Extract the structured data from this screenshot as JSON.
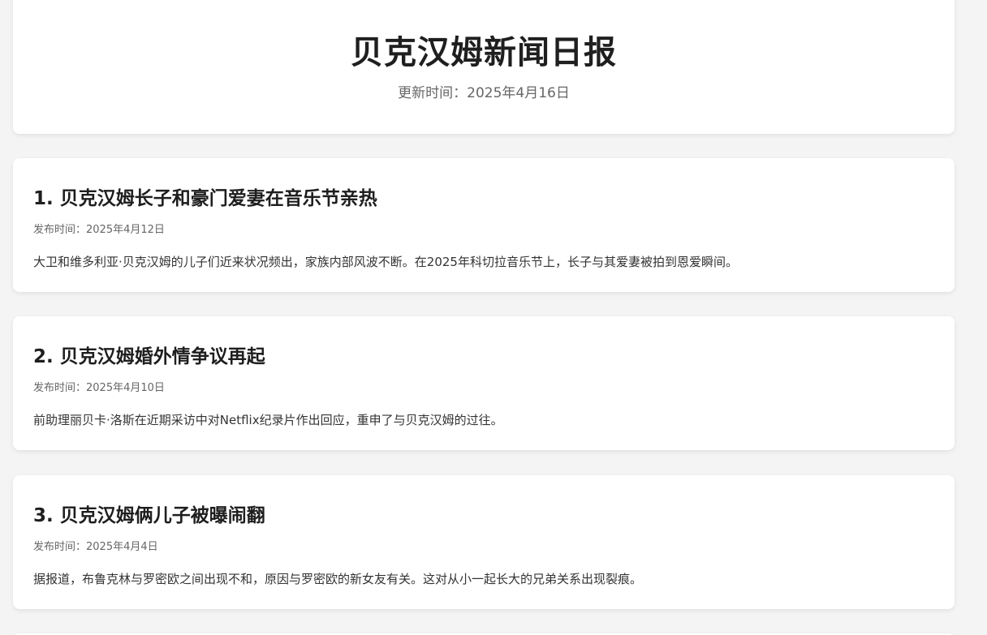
{
  "header": {
    "title": "贝克汉姆新闻日报",
    "update_time": "更新时间：2025年4月16日"
  },
  "news": [
    {
      "title": "1. 贝克汉姆长子和豪门爱妻在音乐节亲热",
      "date": "发布时间：2025年4月12日",
      "summary": "大卫和维多利亚·贝克汉姆的儿子们近来状况频出，家族内部风波不断。在2025年科切拉音乐节上，长子与其爱妻被拍到恩爱瞬间。"
    },
    {
      "title": "2. 贝克汉姆婚外情争议再起",
      "date": "发布时间：2025年4月10日",
      "summary": "前助理丽贝卡·洛斯在近期采访中对Netflix纪录片作出回应，重申了与贝克汉姆的过往。"
    },
    {
      "title": "3. 贝克汉姆俩儿子被曝闹翻",
      "date": "发布时间：2025年4月4日",
      "summary": "据报道，布鲁克林与罗密欧之间出现不和，原因与罗密欧的新女友有关。这对从小一起长大的兄弟关系出现裂痕。"
    }
  ]
}
